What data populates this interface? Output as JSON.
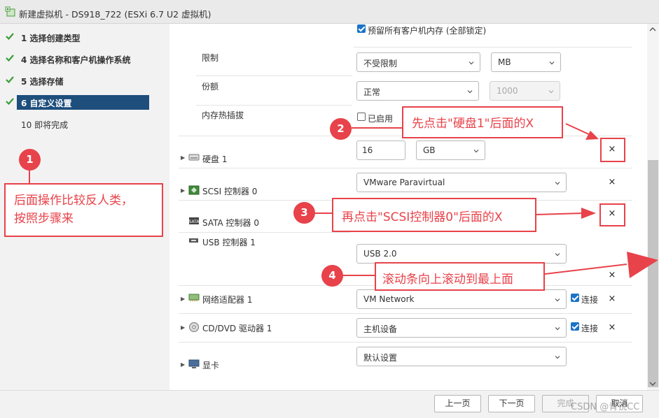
{
  "window": {
    "title": "新建虚拟机 - DS918_722 (ESXi 6.7 U2 虚拟机)"
  },
  "wizard": {
    "steps": [
      {
        "label": "1 选择创建类型",
        "state": "done"
      },
      {
        "label": "4 选择名称和客户机操作系统",
        "state": "done"
      },
      {
        "label": "5 选择存储",
        "state": "done"
      },
      {
        "label": "6 自定义设置",
        "state": "current"
      },
      {
        "label": "10 即将完成",
        "state": "pending"
      }
    ]
  },
  "memory": {
    "reserve_all_label": "预留所有客户机内存 (全部锁定)",
    "reserve_all_checked": true,
    "limit_label": "限制",
    "limit_value": "不受限制",
    "limit_unit": "MB",
    "shares_label": "份额",
    "shares_value": "正常",
    "shares_number": "1000",
    "hotplug_label": "内存热插拔",
    "hotplug_enabled_label": "已启用",
    "hotplug_checked": false
  },
  "devices": {
    "disk": {
      "label": "硬盘 1",
      "size": "16",
      "unit": "GB",
      "remove": "×"
    },
    "scsi": {
      "label": "SCSI 控制器 0",
      "value": "VMware Paravirtual",
      "remove": "×"
    },
    "sata": {
      "label": "SATA 控制器 0",
      "remove": "×"
    },
    "usb": {
      "label": "USB 控制器 1",
      "value": "USB 2.0",
      "remove": "×"
    },
    "network": {
      "label": "网络适配器 1",
      "value": "VM Network",
      "connect_label": "连接",
      "connected": true,
      "remove": "×"
    },
    "cdrom": {
      "label": "CD/DVD 驱动器 1",
      "value": "主机设备",
      "connect_label": "连接",
      "connected": true,
      "remove": "×"
    },
    "video": {
      "label": "显卡",
      "value": "默认设置"
    }
  },
  "footer": {
    "prev": "上一页",
    "next": "下一页",
    "finish": "完成",
    "cancel": "取消",
    "watermark": "CSDN @青锐CC"
  },
  "annotations": {
    "c1": {
      "num": "1",
      "text_line1": "后面操作比较反人类，",
      "text_line2": "按照步骤来"
    },
    "c2": {
      "num": "2",
      "text": "先点击\"硬盘1\"后面的X"
    },
    "c3": {
      "num": "3",
      "text": "再点击\"SCSI控制器0\"后面的X"
    },
    "c4": {
      "num": "4",
      "text": "滚动条向上滚动到最上面"
    }
  },
  "colors": {
    "accent": "#e8424a",
    "selected_step": "#1d4e7c",
    "checkbox": "#1a73c8",
    "check_green": "#3a9c3a"
  }
}
